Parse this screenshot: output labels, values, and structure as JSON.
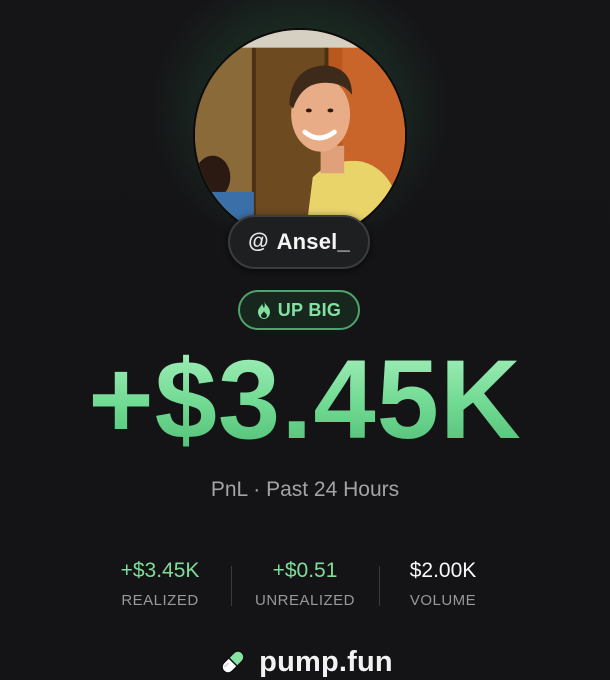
{
  "profile": {
    "handle_at": "@",
    "handle_name": "Ansel_"
  },
  "badge": {
    "label": "UP BIG",
    "icon": "flame-icon"
  },
  "pnl": {
    "value": "+$3.45K",
    "subtitle": "PnL · Past 24 Hours"
  },
  "stats": [
    {
      "value": "+$3.45K",
      "label": "REALIZED"
    },
    {
      "value": "+$0.51",
      "label": "UNREALIZED"
    },
    {
      "value": "$2.00K",
      "label": "VOLUME"
    }
  ],
  "footer": {
    "brand": "pump.fun",
    "icon": "pill-icon"
  },
  "colors": {
    "background": "#121214",
    "accent_green": "#7fdc9a",
    "badge_border": "#4fa36d",
    "muted_text": "#97979c"
  }
}
